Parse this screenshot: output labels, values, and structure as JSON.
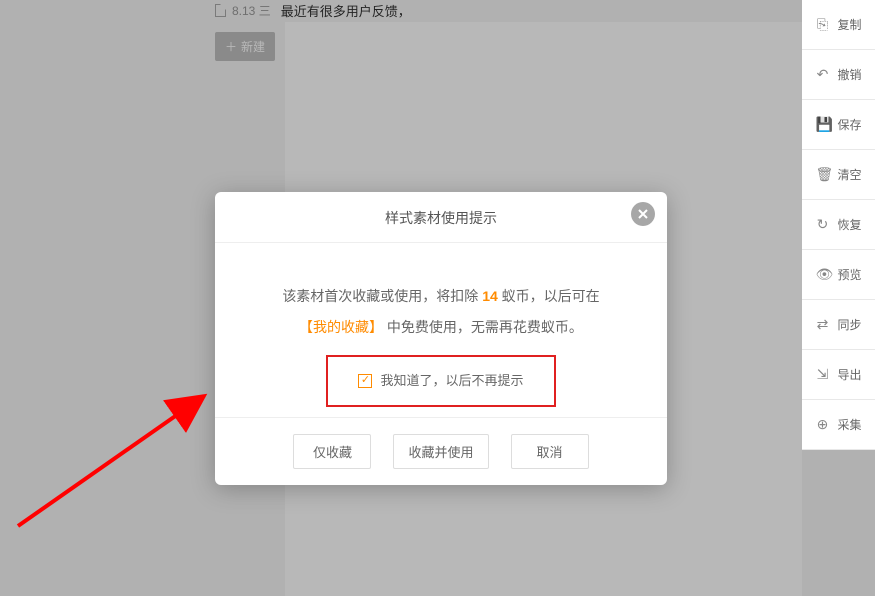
{
  "list_item": {
    "date": "8.13 三",
    "title": "最近有很多用户反馈，"
  },
  "new_button_label": "新建",
  "toolbar": [
    {
      "id": "copy",
      "label": "复制",
      "glyph": "⎘"
    },
    {
      "id": "undo",
      "label": "撤销",
      "glyph": "↶"
    },
    {
      "id": "save",
      "label": "保存",
      "glyph": "💾"
    },
    {
      "id": "clear",
      "label": "清空",
      "glyph": "🗑"
    },
    {
      "id": "restore",
      "label": "恢复",
      "glyph": "↻"
    },
    {
      "id": "preview",
      "label": "预览",
      "glyph": "👁"
    },
    {
      "id": "sync",
      "label": "同步",
      "glyph": "⇄"
    },
    {
      "id": "export",
      "label": "导出",
      "glyph": "⇲"
    },
    {
      "id": "collect",
      "label": "采集",
      "glyph": "⊕"
    }
  ],
  "dialog": {
    "title": "样式素材使用提示",
    "body_prefix": "该素材首次收藏或使用，将扣除 ",
    "cost": "14",
    "body_mid": " 蚁币，以后可在",
    "fav_label": "【我的收藏】",
    "body_suffix": " 中免费使用，无需再花费蚁币。",
    "ack_label": "我知道了，以后不再提示",
    "buttons": {
      "fav_only": "仅收藏",
      "fav_use": "收藏并使用",
      "cancel": "取消"
    }
  }
}
